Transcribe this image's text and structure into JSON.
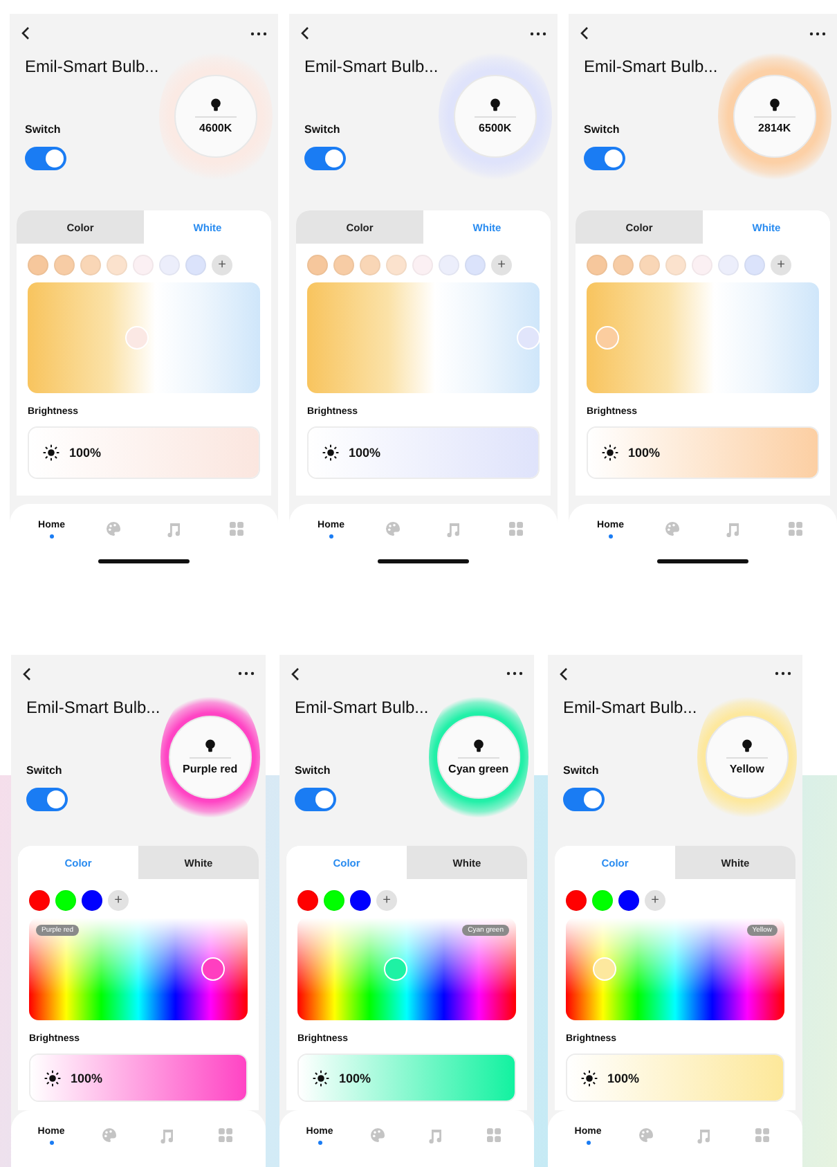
{
  "rows": [
    {
      "screens": [
        {
          "title": "Emil-Smart Bulb...",
          "glow": {
            "readout": "4600K",
            "color": "#fbeae4"
          },
          "switch": {
            "label": "Switch",
            "on": true
          },
          "tabs": [
            {
              "label": "Color",
              "selected": false
            },
            {
              "label": "White",
              "selected": true
            }
          ],
          "swatches": [
            {
              "color": "#f6c79c"
            },
            {
              "color": "#f7cca5"
            },
            {
              "color": "#f9d6b6"
            },
            {
              "color": "#fbe2cd"
            },
            {
              "color": "#fbf0f3"
            },
            {
              "color": "#eceefb"
            },
            {
              "color": "#dbe3fb"
            }
          ],
          "add_label": "+",
          "picker": {
            "kind": "white",
            "level": 0.47,
            "color": "#fbe8e4"
          },
          "brightness": {
            "label": "Brightness",
            "reading": "100%",
            "level": 1,
            "color": "#fbe6df"
          },
          "nav": [
            {
              "kind": "text",
              "label": "Home",
              "selected": true
            },
            {
              "kind": "palette",
              "selected": false
            },
            {
              "kind": "music",
              "selected": false
            },
            {
              "kind": "grid",
              "selected": false
            }
          ],
          "home_indicator": true
        },
        {
          "title": "Emil-Smart Bulb...",
          "glow": {
            "readout": "6500K",
            "color": "#dfe3fb"
          },
          "switch": {
            "label": "Switch",
            "on": true
          },
          "tabs": [
            {
              "label": "Color",
              "selected": false
            },
            {
              "label": "White",
              "selected": true
            }
          ],
          "swatches": [
            {
              "color": "#f6c79c"
            },
            {
              "color": "#f7cca5"
            },
            {
              "color": "#f9d6b6"
            },
            {
              "color": "#fbe2cd"
            },
            {
              "color": "#fbf0f3"
            },
            {
              "color": "#eceefb"
            },
            {
              "color": "#dbe3fb"
            }
          ],
          "add_label": "+",
          "picker": {
            "kind": "white",
            "level": 0.95,
            "color": "#e1e5fb"
          },
          "brightness": {
            "label": "Brightness",
            "reading": "100%",
            "level": 1,
            "color": "#dfe3fb"
          },
          "nav": [
            {
              "kind": "text",
              "label": "Home",
              "selected": true
            },
            {
              "kind": "palette",
              "selected": false
            },
            {
              "kind": "music",
              "selected": false
            },
            {
              "kind": "grid",
              "selected": false
            }
          ],
          "home_indicator": true
        },
        {
          "title": "Emil-Smart Bulb...",
          "glow": {
            "readout": "2814K",
            "color": "#fcd0a6"
          },
          "switch": {
            "label": "Switch",
            "on": true
          },
          "tabs": [
            {
              "label": "Color",
              "selected": false
            },
            {
              "label": "White",
              "selected": true
            }
          ],
          "swatches": [
            {
              "color": "#f6c79c"
            },
            {
              "color": "#f7cca5"
            },
            {
              "color": "#f9d6b6"
            },
            {
              "color": "#fbe2cd"
            },
            {
              "color": "#fbf0f3"
            },
            {
              "color": "#eceefb"
            },
            {
              "color": "#dbe3fb"
            }
          ],
          "add_label": "+",
          "picker": {
            "kind": "white",
            "level": 0.09,
            "color": "#fbcd9f"
          },
          "brightness": {
            "label": "Brightness",
            "reading": "100%",
            "level": 1,
            "color": "#fccfa3"
          },
          "nav": [
            {
              "kind": "text",
              "label": "Home",
              "selected": true
            },
            {
              "kind": "palette",
              "selected": false
            },
            {
              "kind": "music",
              "selected": false
            },
            {
              "kind": "grid",
              "selected": false
            }
          ],
          "home_indicator": true
        }
      ]
    },
    {
      "screens": [
        {
          "title": "Emil-Smart Bulb...",
          "glow": {
            "readout": "Purple red",
            "color": "#ff44c4"
          },
          "switch": {
            "label": "Switch",
            "on": true
          },
          "tabs": [
            {
              "label": "Color",
              "selected": true
            },
            {
              "label": "White",
              "selected": false
            }
          ],
          "swatches": [
            {
              "color": "#ff0000"
            },
            {
              "color": "#00ff00"
            },
            {
              "color": "#0000ff"
            }
          ],
          "add_label": "+",
          "picker": {
            "kind": "color",
            "level": 0.84,
            "color": "#ff3fc0",
            "tag": {
              "text": "Purple red",
              "kind": "left"
            }
          },
          "brightness": {
            "label": "Brightness",
            "reading": "100%",
            "level": 1,
            "color": "#ff44c4"
          },
          "nav": [
            {
              "kind": "text",
              "label": "Home",
              "selected": true
            },
            {
              "kind": "palette",
              "selected": false
            },
            {
              "kind": "music",
              "selected": false
            },
            {
              "kind": "grid",
              "selected": false
            }
          ]
        },
        {
          "title": "Emil-Smart Bulb...",
          "glow": {
            "readout": "Cyan green",
            "color": "#22f0a8"
          },
          "switch": {
            "label": "Switch",
            "on": true
          },
          "tabs": [
            {
              "label": "Color",
              "selected": true
            },
            {
              "label": "White",
              "selected": false
            }
          ],
          "swatches": [
            {
              "color": "#ff0000"
            },
            {
              "color": "#00ff00"
            },
            {
              "color": "#0000ff"
            }
          ],
          "add_label": "+",
          "picker": {
            "kind": "color",
            "level": 0.45,
            "color": "#1ef2a4",
            "tag": {
              "text": "Cyan green",
              "kind": "right"
            }
          },
          "brightness": {
            "label": "Brightness",
            "reading": "100%",
            "level": 1,
            "color": "#12f2a0"
          },
          "nav": [
            {
              "kind": "text",
              "label": "Home",
              "selected": true
            },
            {
              "kind": "palette",
              "selected": false
            },
            {
              "kind": "music",
              "selected": false
            },
            {
              "kind": "grid",
              "selected": false
            }
          ]
        },
        {
          "title": "Emil-Smart Bulb...",
          "glow": {
            "readout": "Yellow",
            "color": "#fde89e"
          },
          "switch": {
            "label": "Switch",
            "on": true
          },
          "tabs": [
            {
              "label": "Color",
              "selected": true
            },
            {
              "label": "White",
              "selected": false
            }
          ],
          "swatches": [
            {
              "color": "#ff0000"
            },
            {
              "color": "#00ff00"
            },
            {
              "color": "#0000ff"
            }
          ],
          "add_label": "+",
          "picker": {
            "kind": "color",
            "level": 0.18,
            "color": "#fde89e",
            "tag": {
              "text": "Yellow",
              "kind": "right"
            }
          },
          "brightness": {
            "label": "Brightness",
            "reading": "100%",
            "level": 1,
            "color": "#fde89a"
          },
          "nav": [
            {
              "kind": "text",
              "label": "Home",
              "selected": true
            },
            {
              "kind": "palette",
              "selected": false
            },
            {
              "kind": "music",
              "selected": false
            },
            {
              "kind": "grid",
              "selected": false
            }
          ]
        }
      ]
    }
  ]
}
